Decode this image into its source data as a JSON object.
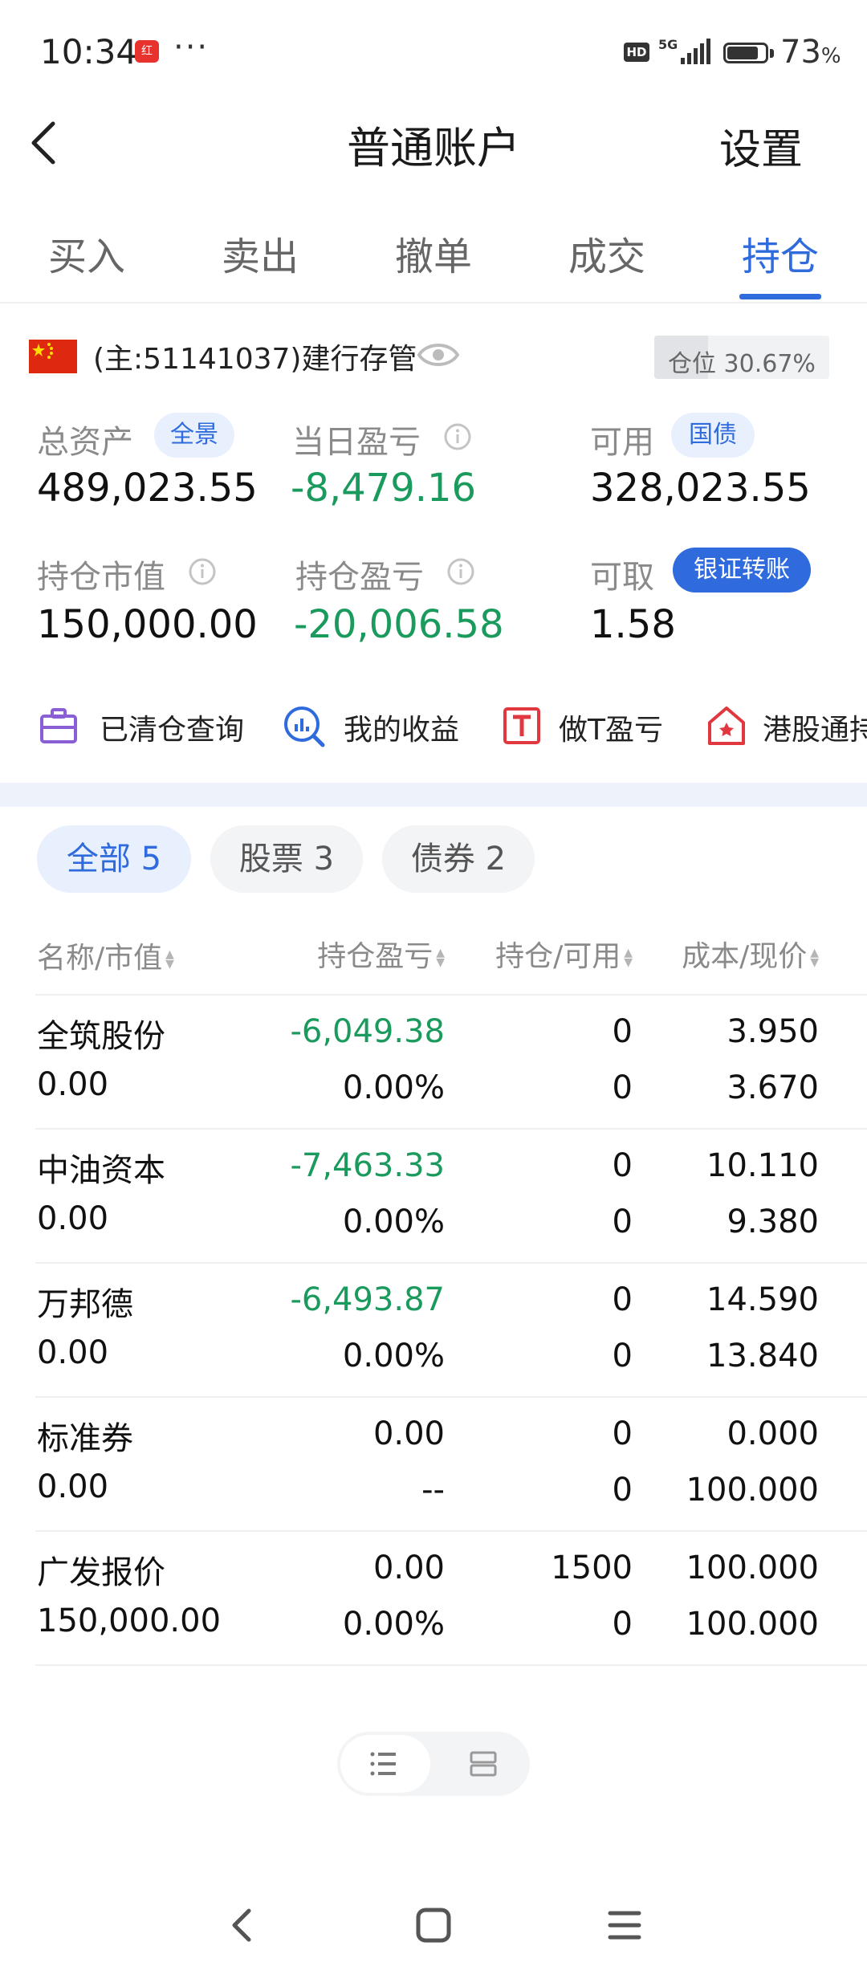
{
  "status_bar": {
    "time": "10:34",
    "app_badge": "红",
    "dots": "···",
    "hd": "HD",
    "network": "5G",
    "battery_pct": "73",
    "battery_unit": "%"
  },
  "header": {
    "title": "普通账户",
    "settings_label": "设置"
  },
  "tabs": [
    {
      "label": "买入"
    },
    {
      "label": "卖出"
    },
    {
      "label": "撤单"
    },
    {
      "label": "成交"
    },
    {
      "label": "持仓",
      "active": true
    }
  ],
  "account": {
    "label": "(主:51141037)建行存管",
    "position_label": "仓位 30.67%",
    "position_fraction": 0.3067
  },
  "summary": {
    "total_assets": {
      "label": "总资产",
      "badge": "全景",
      "value": "489,023.55"
    },
    "daily_pl": {
      "label": "当日盈亏",
      "value": "-8,479.16"
    },
    "available": {
      "label": "可用",
      "badge": "国债",
      "value": "328,023.55"
    },
    "market_value": {
      "label": "持仓市值",
      "value": "150,000.00"
    },
    "position_pl": {
      "label": "持仓盈亏",
      "value": "-20,006.58"
    },
    "withdrawable": {
      "label": "可取",
      "badge": "银证转账",
      "value": "1.58"
    }
  },
  "quick_actions": [
    {
      "label": "已清仓查询",
      "icon": "briefcase-icon"
    },
    {
      "label": "我的收益",
      "icon": "chart-search-icon"
    },
    {
      "label": "做T盈亏",
      "icon": "t-box-icon"
    },
    {
      "label": "港股通持",
      "icon": "hk-home-icon"
    }
  ],
  "filters": [
    {
      "label": "全部 5",
      "active": true
    },
    {
      "label": "股票 3"
    },
    {
      "label": "债券 2"
    }
  ],
  "table": {
    "headers": [
      "名称/市值",
      "持仓盈亏",
      "持仓/可用",
      "成本/现价"
    ],
    "rows": [
      {
        "name": "全筑股份",
        "value": "0.00",
        "pl": "-6,049.38",
        "pl_pct": "0.00%",
        "hold": "0",
        "avail": "0",
        "cost": "3.950",
        "price": "3.670",
        "neg": true
      },
      {
        "name": "中油资本",
        "value": "0.00",
        "pl": "-7,463.33",
        "pl_pct": "0.00%",
        "hold": "0",
        "avail": "0",
        "cost": "10.110",
        "price": "9.380",
        "neg": true
      },
      {
        "name": "万邦德",
        "value": "0.00",
        "pl": "-6,493.87",
        "pl_pct": "0.00%",
        "hold": "0",
        "avail": "0",
        "cost": "14.590",
        "price": "13.840",
        "neg": true
      },
      {
        "name": "标准券",
        "value": "0.00",
        "pl": "0.00",
        "pl_pct": "--",
        "hold": "0",
        "avail": "0",
        "cost": "0.000",
        "price": "100.000",
        "neg": false
      },
      {
        "name": "广发报价",
        "value": "150,000.00",
        "pl": "0.00",
        "pl_pct": "0.00%",
        "hold": "1500",
        "avail": "0",
        "cost": "100.000",
        "price": "100.000",
        "neg": false
      }
    ]
  },
  "colors": {
    "accent": "#2f6bdc",
    "loss_green": "#1a9a5c",
    "flag_red": "#de2910"
  }
}
